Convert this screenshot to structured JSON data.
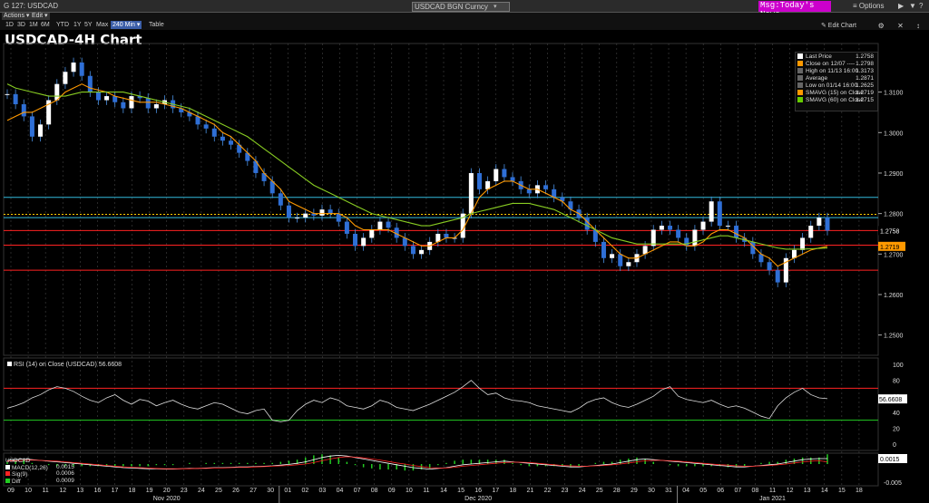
{
  "topbar": {
    "left": "G 127: USDCAD",
    "ticker": "USDCAD BGN Curncy",
    "trigger": "▾",
    "msg": "Msg:Today's News",
    "options": "≡ Options",
    "win_controls": [
      "▶",
      "▼",
      "?"
    ]
  },
  "menu": {
    "actions": "Actions ▾",
    "edit": "Edit ▾"
  },
  "ranges": [
    {
      "label": "1D",
      "active": false
    },
    {
      "label": "3D",
      "active": false
    },
    {
      "label": "1M",
      "active": false
    },
    {
      "label": "6M",
      "active": false
    },
    {
      "label": "YTD",
      "active": false
    },
    {
      "label": "1Y",
      "active": false
    },
    {
      "label": "5Y",
      "active": false
    },
    {
      "label": "Max",
      "active": false
    },
    {
      "label": "240 Min ▾",
      "active": true
    },
    {
      "label": "Table",
      "active": false
    }
  ],
  "edit_chart": "✎ Edit Chart",
  "window_ctrl": "⚙ ✕ ↕",
  "title": "USDCAD-4H Chart",
  "legend": [
    {
      "label": "Last Price",
      "value": "1.2758",
      "color": "#ffffff"
    },
    {
      "label": "Close on 12/07 ----",
      "value": "1.2798",
      "color": "#ff9900"
    },
    {
      "label": "High on 11/13 16:00",
      "value": "1.3173",
      "color": "#666666"
    },
    {
      "label": "Average",
      "value": "1.2871",
      "color": "#666666"
    },
    {
      "label": "Low on 01/14 16:00",
      "value": "1.2625",
      "color": "#666666"
    },
    {
      "label": "SMAVG (15)  on Close",
      "value": "1.2719",
      "color": "#ff9900"
    },
    {
      "label": "SMAVG (60)  on Close",
      "value": "1.2715",
      "color": "#66cc00"
    }
  ],
  "price_ticks": [
    "1.3100",
    "1.3000",
    "1.2900",
    "1.2800",
    "1.2700",
    "1.2600",
    "1.2500"
  ],
  "price_tags": {
    "last": "1.2758",
    "sma15": "1.2719"
  },
  "rsi": {
    "label": "RSI (14)  on Close (USDCAD) 56.6608",
    "ticks": [
      "100",
      "80",
      "60",
      "40",
      "20",
      "0"
    ],
    "tag": "56.6608"
  },
  "macd": {
    "title": "USDCAD",
    "rows": [
      {
        "label": "MACD(12,26)",
        "value": "0.0015",
        "color": "#ffffff"
      },
      {
        "label": "Sig(9)",
        "value": "0.0006",
        "color": "#ff2222"
      },
      {
        "label": "Diff",
        "value": "0.0009",
        "color": "#22cc22"
      }
    ],
    "ticks": [
      "0.0015",
      "-0.005"
    ]
  },
  "xaxis": {
    "days": [
      "09",
      "10",
      "11",
      "12",
      "13",
      "16",
      "17",
      "18",
      "19",
      "20",
      "23",
      "24",
      "25",
      "26",
      "27",
      "30",
      "01",
      "02",
      "03",
      "04",
      "07",
      "08",
      "09",
      "10",
      "11",
      "14",
      "15",
      "16",
      "17",
      "18",
      "21",
      "22",
      "23",
      "24",
      "25",
      "28",
      "29",
      "30",
      "31",
      "04",
      "05",
      "06",
      "07",
      "08",
      "11",
      "12",
      "13",
      "14",
      "15",
      "18"
    ],
    "months": [
      {
        "label": "Nov 2020",
        "day_index": 9
      },
      {
        "label": "Dec 2020",
        "day_index": 27
      },
      {
        "label": "Jan 2021",
        "day_index": 44
      }
    ]
  },
  "chart_data": {
    "type": "candlestick",
    "title": "USDCAD-4H Chart",
    "price_ylim": [
      1.245,
      1.322
    ],
    "price_series_close": [
      1.3095,
      1.307,
      1.304,
      1.299,
      1.302,
      1.308,
      1.312,
      1.315,
      1.3173,
      1.314,
      1.31,
      1.308,
      1.309,
      1.3075,
      1.306,
      1.309,
      1.3085,
      1.306,
      1.307,
      1.308,
      1.306,
      1.305,
      1.304,
      1.302,
      1.301,
      1.299,
      1.298,
      1.297,
      1.295,
      1.293,
      1.29,
      1.288,
      1.285,
      1.282,
      1.279,
      1.279,
      1.28,
      1.2795,
      1.281,
      1.28,
      1.278,
      1.275,
      1.272,
      1.274,
      1.276,
      1.278,
      1.2765,
      1.274,
      1.272,
      1.27,
      1.271,
      1.273,
      1.275,
      1.274,
      1.274,
      1.28,
      1.29,
      1.286,
      1.288,
      1.291,
      1.289,
      1.288,
      1.286,
      1.285,
      1.287,
      1.286,
      1.284,
      1.283,
      1.281,
      1.279,
      1.276,
      1.273,
      1.269,
      1.27,
      1.267,
      1.268,
      1.27,
      1.272,
      1.276,
      1.277,
      1.276,
      1.274,
      1.272,
      1.276,
      1.278,
      1.283,
      1.277,
      1.277,
      1.274,
      1.273,
      1.27,
      1.268,
      1.266,
      1.263,
      1.269,
      1.271,
      1.274,
      1.277,
      1.279,
      1.2758
    ],
    "sma15": [
      1.303,
      1.304,
      1.305,
      1.305,
      1.306,
      1.307,
      1.308,
      1.31,
      1.311,
      1.312,
      1.311,
      1.3105,
      1.31,
      1.309,
      1.3085,
      1.308,
      1.3075,
      1.3075,
      1.3075,
      1.307,
      1.3065,
      1.306,
      1.305,
      1.304,
      1.303,
      1.302,
      1.3,
      1.299,
      1.297,
      1.295,
      1.293,
      1.29,
      1.288,
      1.286,
      1.283,
      1.282,
      1.281,
      1.28,
      1.28,
      1.28,
      1.28,
      1.279,
      1.277,
      1.276,
      1.276,
      1.276,
      1.276,
      1.275,
      1.274,
      1.273,
      1.272,
      1.272,
      1.273,
      1.274,
      1.274,
      1.276,
      1.28,
      1.284,
      1.286,
      1.287,
      1.288,
      1.288,
      1.287,
      1.286,
      1.286,
      1.285,
      1.284,
      1.283,
      1.281,
      1.28,
      1.278,
      1.276,
      1.274,
      1.272,
      1.27,
      1.269,
      1.269,
      1.27,
      1.271,
      1.272,
      1.273,
      1.273,
      1.272,
      1.272,
      1.273,
      1.275,
      1.276,
      1.276,
      1.275,
      1.274,
      1.272,
      1.27,
      1.269,
      1.267,
      1.268,
      1.269,
      1.27,
      1.271,
      1.2715,
      1.2719
    ],
    "sma60": [
      1.312,
      1.311,
      1.3105,
      1.31,
      1.3095,
      1.309,
      1.309,
      1.309,
      1.3095,
      1.31,
      1.31,
      1.31,
      1.31,
      1.31,
      1.31,
      1.3095,
      1.309,
      1.3085,
      1.308,
      1.3075,
      1.307,
      1.3065,
      1.306,
      1.305,
      1.304,
      1.303,
      1.302,
      1.301,
      1.3,
      1.299,
      1.2975,
      1.296,
      1.2945,
      1.293,
      1.2915,
      1.29,
      1.2885,
      1.287,
      1.286,
      1.285,
      1.284,
      1.283,
      1.282,
      1.281,
      1.28,
      1.2795,
      1.279,
      1.2785,
      1.278,
      1.2775,
      1.277,
      1.277,
      1.2775,
      1.278,
      1.2785,
      1.279,
      1.28,
      1.2805,
      1.281,
      1.2815,
      1.282,
      1.2825,
      1.2825,
      1.2825,
      1.282,
      1.2815,
      1.281,
      1.28,
      1.279,
      1.278,
      1.277,
      1.276,
      1.275,
      1.274,
      1.2735,
      1.273,
      1.2725,
      1.2725,
      1.2725,
      1.2725,
      1.2725,
      1.2725,
      1.2725,
      1.273,
      1.2735,
      1.274,
      1.2745,
      1.2745,
      1.274,
      1.2735,
      1.273,
      1.2725,
      1.272,
      1.2715,
      1.2712,
      1.2712,
      1.2712,
      1.2713,
      1.2714,
      1.2715
    ],
    "hlines": [
      {
        "y": 1.284,
        "color": "#33bbdd"
      },
      {
        "y": 1.2798,
        "color": "#ffcc00",
        "dashed": true
      },
      {
        "y": 1.279,
        "color": "#33bbdd"
      },
      {
        "y": 1.2758,
        "color": "#ff2222"
      },
      {
        "y": 1.2722,
        "color": "#ff2222"
      },
      {
        "y": 1.266,
        "color": "#ff2222"
      }
    ],
    "rsi_ylim": [
      -8,
      108
    ],
    "rsi_levels": [
      70,
      30
    ],
    "rsi_values": [
      45,
      48,
      52,
      58,
      62,
      68,
      72,
      70,
      66,
      60,
      55,
      52,
      58,
      62,
      55,
      50,
      56,
      54,
      48,
      52,
      55,
      50,
      46,
      44,
      48,
      52,
      50,
      45,
      40,
      38,
      42,
      44,
      30,
      28,
      30,
      42,
      50,
      55,
      52,
      58,
      55,
      48,
      46,
      44,
      48,
      55,
      52,
      46,
      44,
      42,
      46,
      50,
      55,
      60,
      65,
      72,
      80,
      70,
      62,
      64,
      58,
      55,
      54,
      52,
      48,
      46,
      44,
      42,
      40,
      45,
      52,
      56,
      58,
      52,
      48,
      46,
      50,
      55,
      60,
      68,
      72,
      60,
      56,
      54,
      52,
      55,
      50,
      46,
      48,
      45,
      40,
      35,
      32,
      48,
      58,
      65,
      70,
      62,
      58,
      57
    ],
    "macd_ylim": [
      -0.006,
      0.003
    ],
    "macd_values": [
      0.001,
      0.0012,
      0.0014,
      0.0012,
      0.001,
      0.0008,
      0.0006,
      0.0004,
      0.0002,
      0.0,
      -0.0002,
      -0.0004,
      -0.0006,
      -0.0008,
      -0.001,
      -0.0011,
      -0.0012,
      -0.0013,
      -0.0013,
      -0.0014,
      -0.0014,
      -0.0013,
      -0.0012,
      -0.0012,
      -0.0011,
      -0.001,
      -0.001,
      -0.0009,
      -0.0008,
      -0.0008,
      -0.0007,
      -0.0006,
      -0.0005,
      -0.0003,
      -0.0001,
      0.0002,
      0.0006,
      0.0012,
      0.0018,
      0.0022,
      0.0024,
      0.0022,
      0.0018,
      0.0014,
      0.001,
      0.0006,
      0.0002,
      -0.0002,
      -0.0006,
      -0.001,
      -0.0012,
      -0.0014,
      -0.0012,
      -0.001,
      -0.0006,
      -0.0002,
      0.0,
      0.0002,
      0.0004,
      0.0006,
      0.0008,
      0.0006,
      0.0004,
      0.0002,
      0.0,
      -0.0002,
      -0.0004,
      -0.0006,
      -0.0008,
      -0.0008,
      -0.0006,
      -0.0004,
      -0.0002,
      0.0,
      0.0004,
      0.0008,
      0.0012,
      0.0014,
      0.0012,
      0.001,
      0.0008,
      0.0006,
      0.0004,
      0.0002,
      0.0,
      -0.0002,
      -0.0004,
      -0.0006,
      -0.0008,
      -0.0008,
      -0.0006,
      -0.0004,
      -0.0002,
      0.0,
      0.0004,
      0.0008,
      0.0012,
      0.0014,
      0.0015,
      0.0015
    ],
    "macd_signal": [
      0.0008,
      0.0009,
      0.001,
      0.0011,
      0.001,
      0.0009,
      0.0008,
      0.0006,
      0.0004,
      0.0002,
      0.0,
      -0.0002,
      -0.0004,
      -0.0006,
      -0.0008,
      -0.0009,
      -0.001,
      -0.0011,
      -0.0012,
      -0.0013,
      -0.0013,
      -0.0013,
      -0.0013,
      -0.0012,
      -0.0012,
      -0.0011,
      -0.0011,
      -0.001,
      -0.0009,
      -0.0009,
      -0.0008,
      -0.0007,
      -0.0006,
      -0.0005,
      -0.0004,
      -0.0002,
      0.0,
      0.0004,
      0.0009,
      0.0014,
      0.0018,
      0.002,
      0.0019,
      0.0017,
      0.0014,
      0.0011,
      0.0007,
      0.0003,
      0.0,
      -0.0004,
      -0.0007,
      -0.001,
      -0.0011,
      -0.0011,
      -0.0009,
      -0.0006,
      -0.0004,
      -0.0002,
      0.0,
      0.0002,
      0.0004,
      0.0005,
      0.0005,
      0.0004,
      0.0002,
      0.0,
      -0.0002,
      -0.0004,
      -0.0005,
      -0.0006,
      -0.0006,
      -0.0005,
      -0.0004,
      -0.0002,
      0.0,
      0.0003,
      0.0006,
      0.0009,
      0.001,
      0.001,
      0.0009,
      0.0008,
      0.0006,
      0.0004,
      0.0002,
      0.0,
      -0.0002,
      -0.0003,
      -0.0005,
      -0.0006,
      -0.0006,
      -0.0005,
      -0.0004,
      -0.0002,
      0.0,
      0.0003,
      0.0006,
      0.0008,
      0.0009,
      0.0006
    ]
  }
}
